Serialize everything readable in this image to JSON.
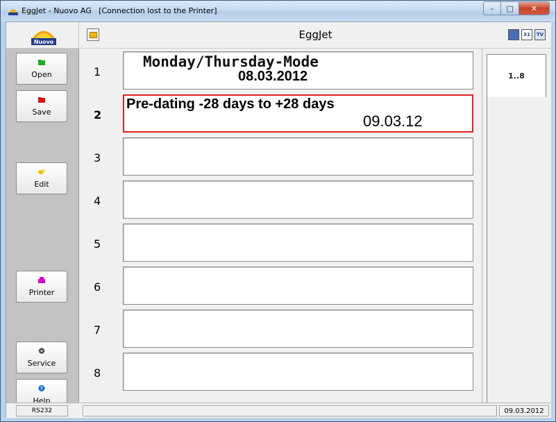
{
  "window": {
    "title": "EggJet - Nuovo AG   [Connection lost to the Printer]",
    "caption_buttons": [
      "minimize",
      "maximize",
      "close"
    ]
  },
  "header": {
    "logo_text": "Nuovo",
    "app_title": "EggJet",
    "tool_icons": [
      "display-icon",
      "calendar-icon",
      "tv-icon"
    ],
    "calendar_label": "31",
    "tv_label": "TV"
  },
  "sidebar": {
    "buttons": [
      {
        "label": "Open",
        "icon": "folder-green-icon",
        "color": "#22aa22"
      },
      {
        "label": "Save",
        "icon": "folder-red-icon",
        "color": "#dd1111"
      },
      {
        "label": "Edit",
        "icon": "edit-icon",
        "color": "#e6c200"
      },
      {
        "label": "Printer",
        "icon": "printer-icon",
        "color": "#d000d0"
      },
      {
        "label": "Service",
        "icon": "gear-icon",
        "color": "#555555"
      },
      {
        "label": "Help",
        "icon": "help-icon",
        "color": "#1a66d6"
      }
    ]
  },
  "rows": [
    {
      "num": "1",
      "line1": "Monday/Thursday-Mode",
      "line2": "08.03.2012"
    },
    {
      "num": "2",
      "line1": "Pre-dating -28 days to +28 days",
      "line2": "09.03.12",
      "selected": true
    },
    {
      "num": "3",
      "line1": "",
      "line2": ""
    },
    {
      "num": "4",
      "line1": "",
      "line2": ""
    },
    {
      "num": "5",
      "line1": "",
      "line2": ""
    },
    {
      "num": "6",
      "line1": "",
      "line2": ""
    },
    {
      "num": "7",
      "line1": "",
      "line2": ""
    },
    {
      "num": "8",
      "line1": "",
      "line2": ""
    }
  ],
  "tabs": {
    "range_label": "1..8"
  },
  "statusbar": {
    "port": "RS232",
    "message": "",
    "date": "09.03.2012"
  },
  "colors": {
    "selection_border": "#e02020",
    "sidebar_bg": "#c3c3c3"
  }
}
